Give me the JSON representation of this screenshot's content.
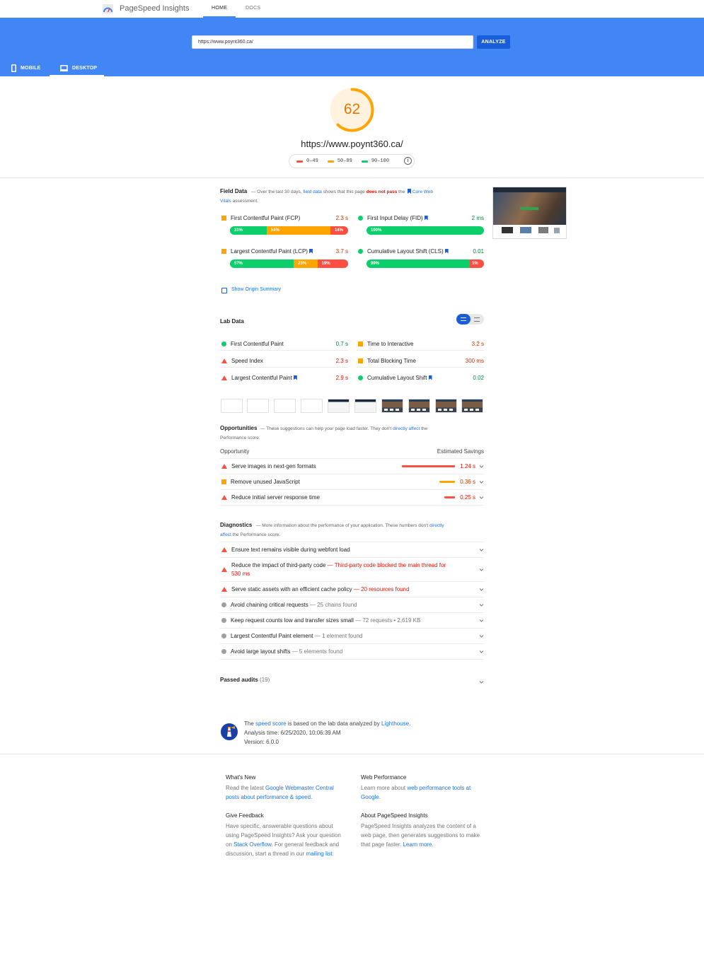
{
  "app": {
    "title": "PageSpeed Insights",
    "tabs": [
      "HOME",
      "DOCS"
    ]
  },
  "search": {
    "url": "https://www.poynt360.ca/",
    "analyze_label": "ANALYZE"
  },
  "devices": {
    "mobile": "MOBILE",
    "desktop": "DESKTOP"
  },
  "score": {
    "value": "62",
    "fraction": 0.62,
    "color": "#ffa400",
    "url": "https://www.poynt360.ca/"
  },
  "legend": [
    "0–49",
    "50–89",
    "90–100"
  ],
  "colors": {
    "fail": "#ff4e42",
    "average": "#ffa400",
    "pass": "#0cce6b",
    "accent": "#1a5dd8",
    "hero": "#4285f4"
  },
  "field_data": {
    "title": "Field Data",
    "desc_pre": "— Over the last 30 days,",
    "desc_link1": "field data",
    "desc_mid": "shows that this page",
    "desc_fail": "does not pass",
    "desc_the": "the",
    "desc_link2a": "Core Web",
    "desc_link2b": "Vitals",
    "desc_post": "assessment.",
    "metrics": [
      {
        "label": "First Contentful Paint (FCP)",
        "value": "2.3 s",
        "dist": [
          "31%",
          "54%",
          "14%"
        ]
      },
      {
        "label": "First Input Delay (FID)",
        "value": "2 ms",
        "dist": [
          "100%"
        ]
      },
      {
        "label": "Largest Contentful Paint (LCP)",
        "value": "3.7 s",
        "dist": [
          "57%",
          "23%",
          "19%"
        ]
      },
      {
        "label": "Cumulative Layout Shift (CLS)",
        "value": "0.01",
        "dist": [
          "99%",
          "1%"
        ]
      }
    ],
    "origin_summary": "Show Origin Summary"
  },
  "lab_data": {
    "title": "Lab Data",
    "metrics": [
      {
        "label": "First Contentful Paint",
        "value": "0.7 s"
      },
      {
        "label": "Time to Interactive",
        "value": "3.2 s"
      },
      {
        "label": "Speed Index",
        "value": "2.3 s"
      },
      {
        "label": "Total Blocking Time",
        "value": "300 ms"
      },
      {
        "label": "Largest Contentful Paint",
        "value": "2.9 s"
      },
      {
        "label": "Cumulative Layout Shift",
        "value": "0.02"
      }
    ]
  },
  "opportunities": {
    "title": "Opportunities",
    "desc_pre": "— These suggestions can help your page load faster. They don't",
    "desc_link": "directly affect",
    "desc_post": "the",
    "desc_line2": "Performance score.",
    "col_left": "Opportunity",
    "col_right": "Estimated Savings",
    "items": [
      {
        "label": "Serve images in next-gen formats",
        "value": "1.24 s"
      },
      {
        "label": "Remove unused JavaScript",
        "value": "0.36 s"
      },
      {
        "label": "Reduce initial server response time",
        "value": "0.25 s"
      }
    ]
  },
  "diagnostics": {
    "title": "Diagnostics",
    "desc_pre": "— More information about the performance of your application. These numbers don't",
    "desc_link1": "directly",
    "desc_link2": "affect",
    "desc_post": "the Performance score.",
    "items": [
      {
        "label": "Ensure text remains visible during webfont load",
        "detail": ""
      },
      {
        "label": "Reduce the impact of third-party code",
        "detail": "— Third-party code blocked the main thread for",
        "detail2": "530 ms"
      },
      {
        "label": "Serve static assets with an efficient cache policy",
        "detail": "— 20 resources found"
      },
      {
        "label": "Avoid chaining critical requests",
        "detail": "— 25 chains found"
      },
      {
        "label": "Keep request counts low and transfer sizes small",
        "detail": "— 72 requests • 2,619 KB"
      },
      {
        "label": "Largest Contentful Paint element",
        "detail": "— 1 element found"
      },
      {
        "label": "Avoid large layout shifts",
        "detail": "— 5 elements found"
      }
    ]
  },
  "passed": {
    "label": "Passed audits",
    "count": "(19)"
  },
  "info": {
    "the": "The",
    "speed_score": "speed score",
    "based": "is based on the lab data analyzed by",
    "lighthouse": "Lighthouse",
    "period": ".",
    "analysis_time": "Analysis time: 6/25/2020, 10:06:39 AM",
    "version": "Version: 6.0.0"
  },
  "footer": {
    "whats_new": {
      "title": "What's New",
      "pre": "Read the latest",
      "link": "Google Webmaster Central posts about performance & speed",
      "post": "."
    },
    "web_perf": {
      "title": "Web Performance",
      "pre": "Learn more about",
      "link": "web performance tools at Google",
      "post": "."
    },
    "feedback": {
      "title": "Give Feedback",
      "pre": "Have specific, answerable questions about using PageSpeed Insights? Ask your question on",
      "link1": "Stack Overflow",
      "mid": ". For general feedback and discussion, start a thread in our",
      "link2": "mailing list",
      "post": "."
    },
    "about": {
      "title": "About PageSpeed Insights",
      "pre": "PageSpeed Insights analyzes the content of a web page, then generates suggestions to make that page faster.",
      "link": "Learn more",
      "post": "."
    }
  }
}
